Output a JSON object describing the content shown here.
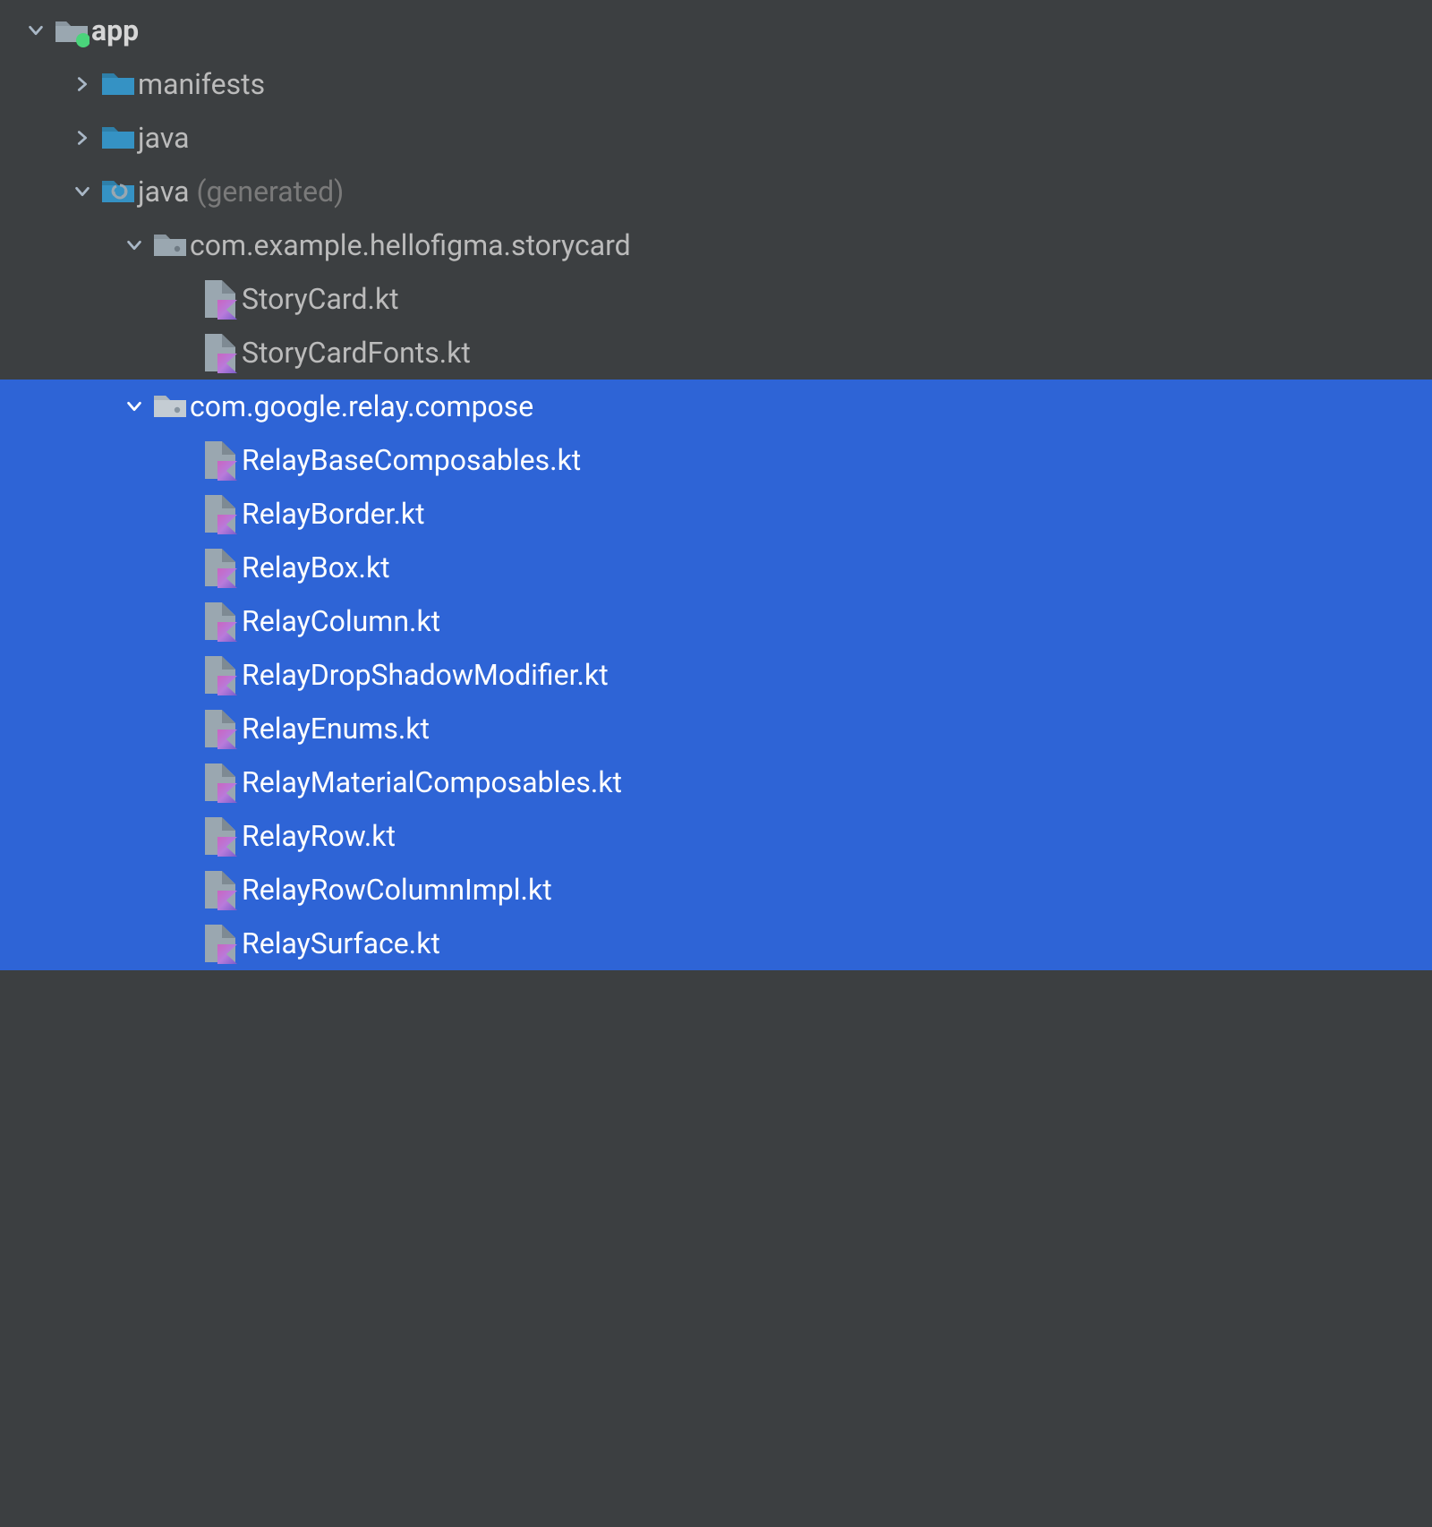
{
  "tree": {
    "app": {
      "label": "app",
      "manifests": {
        "label": "manifests"
      },
      "java_src": {
        "label": "java"
      },
      "java_gen": {
        "label": "java",
        "suffix": "(generated)",
        "pkg_storycard": {
          "label": "com.example.hellofigma.storycard",
          "file_0": "StoryCard.kt",
          "file_1": "StoryCardFonts.kt"
        },
        "pkg_relay": {
          "label": "com.google.relay.compose",
          "file_0": "RelayBaseComposables.kt",
          "file_1": "RelayBorder.kt",
          "file_2": "RelayBox.kt",
          "file_3": "RelayColumn.kt",
          "file_4": "RelayDropShadowModifier.kt",
          "file_5": "RelayEnums.kt",
          "file_6": "RelayMaterialComposables.kt",
          "file_7": "RelayRow.kt",
          "file_8": "RelayRowColumnImpl.kt",
          "file_9": "RelaySurface.kt"
        }
      }
    }
  },
  "colors": {
    "bg": "#3C3F41",
    "text": "#BBBBBB",
    "muted": "#7A7A7A",
    "selection": "#2E64D6",
    "folder_teal": "#3592C4",
    "folder_gray": "#9AA7B0",
    "module_dot": "#4AD47B",
    "arrow": "#A9B7C6",
    "arrow_sel": "#FFFFFF"
  }
}
